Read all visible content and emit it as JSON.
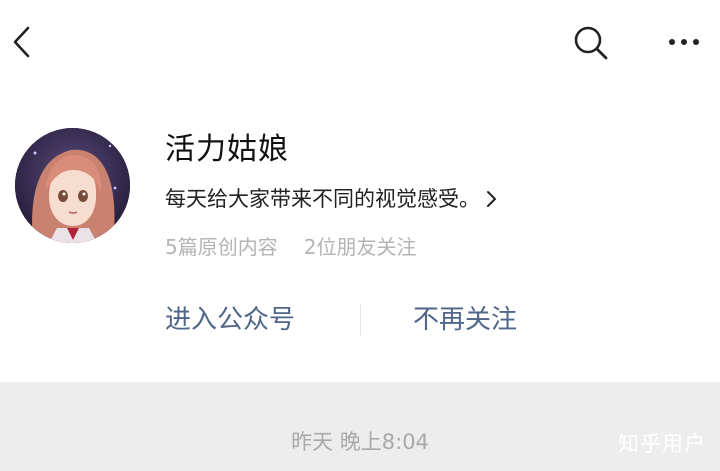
{
  "header": {
    "back_icon": "chevron-left-icon",
    "search_icon": "search-icon",
    "more_icon": "more-horizontal-icon"
  },
  "account": {
    "name": "活力姑娘",
    "intro": "每天给大家带来不同的视觉感受。",
    "original_count": "5篇原创内容",
    "friends_following": "2位朋友关注"
  },
  "actions": {
    "enter": "进入公众号",
    "unfollow": "不再关注"
  },
  "message": {
    "timestamp": "昨天 晚上8:04"
  },
  "watermark": "知乎用户",
  "colors": {
    "link": "#4f6688",
    "muted": "#b4b4b4",
    "footer_bg": "#ededed"
  }
}
